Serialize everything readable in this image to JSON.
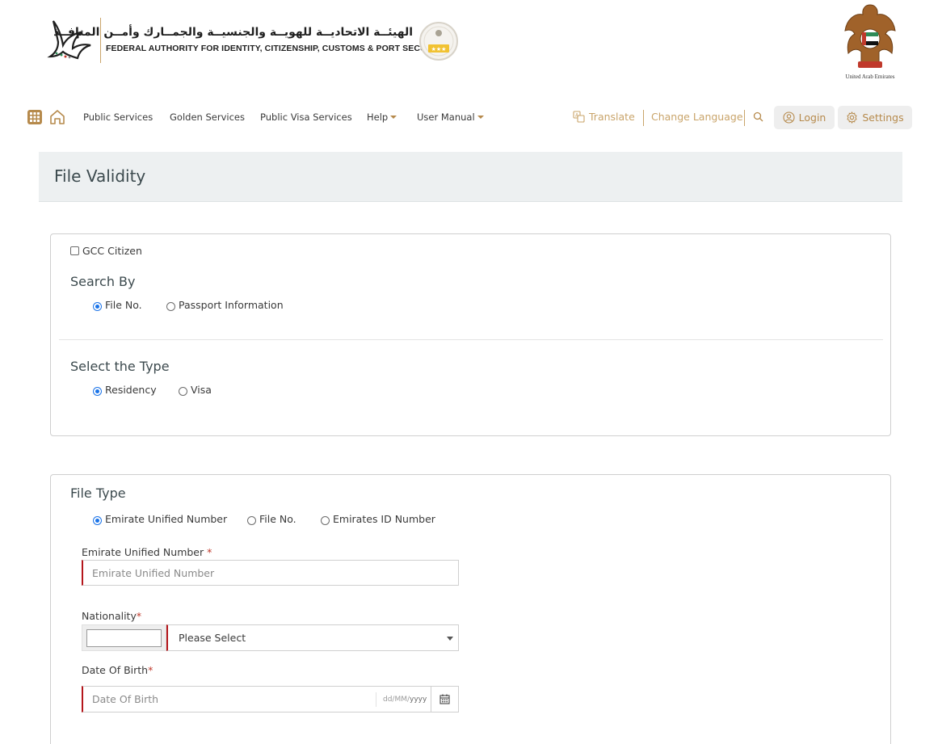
{
  "header": {
    "authority_name_ar": "الهيئــة الاتحاديــة للهويــة والجنسيــة والجمــارك وأمــن المنافــذ",
    "authority_name_en": "FEDERAL AUTHORITY FOR IDENTITY, CITIZENSHIP, CUSTOMS & PORT SECURITY",
    "emblem_caption": "United Arab Emirates"
  },
  "nav": {
    "links": [
      "Public Services",
      "Golden Services",
      "Public Visa Services",
      "Help",
      "User Manual"
    ],
    "translate": "Translate",
    "change_language": "Change Language",
    "login": "Login",
    "settings": "Settings"
  },
  "page": {
    "title": "File Validity"
  },
  "search_card": {
    "gcc_label": "GCC Citizen",
    "search_by": {
      "label": "Search By",
      "options": [
        "File No.",
        "Passport Information"
      ],
      "selected": "File No."
    },
    "type": {
      "label": "Select the Type",
      "options": [
        "Residency",
        "Visa"
      ],
      "selected": "Residency"
    }
  },
  "file_card": {
    "file_type": {
      "label": "File Type",
      "options": [
        "Emirate Unified Number",
        "File No.",
        "Emirates ID Number"
      ],
      "selected": "Emirate Unified Number"
    },
    "unified_number": {
      "label": "Emirate Unified Number",
      "required_mark": "*",
      "placeholder": "Emirate Unified Number",
      "value": ""
    },
    "nationality": {
      "label": "Nationality",
      "required_mark": "*",
      "code_value": "",
      "selected": "Please Select"
    },
    "dob": {
      "label": "Date Of Birth",
      "required_mark": "*",
      "placeholder": "Date Of Birth",
      "format_prefix": "dd/MM/",
      "format_suffix": "yyyy"
    }
  },
  "colors": {
    "accent_gold": "#c9a46a",
    "required_red": "#b4161b",
    "radio_blue": "#1a73e8",
    "title_band": "#edf0f1"
  },
  "icons": [
    "apps-grid-icon",
    "home-icon",
    "translate-icon",
    "search-icon",
    "user-icon",
    "gear-icon",
    "calendar-icon",
    "chevron-down-icon"
  ]
}
